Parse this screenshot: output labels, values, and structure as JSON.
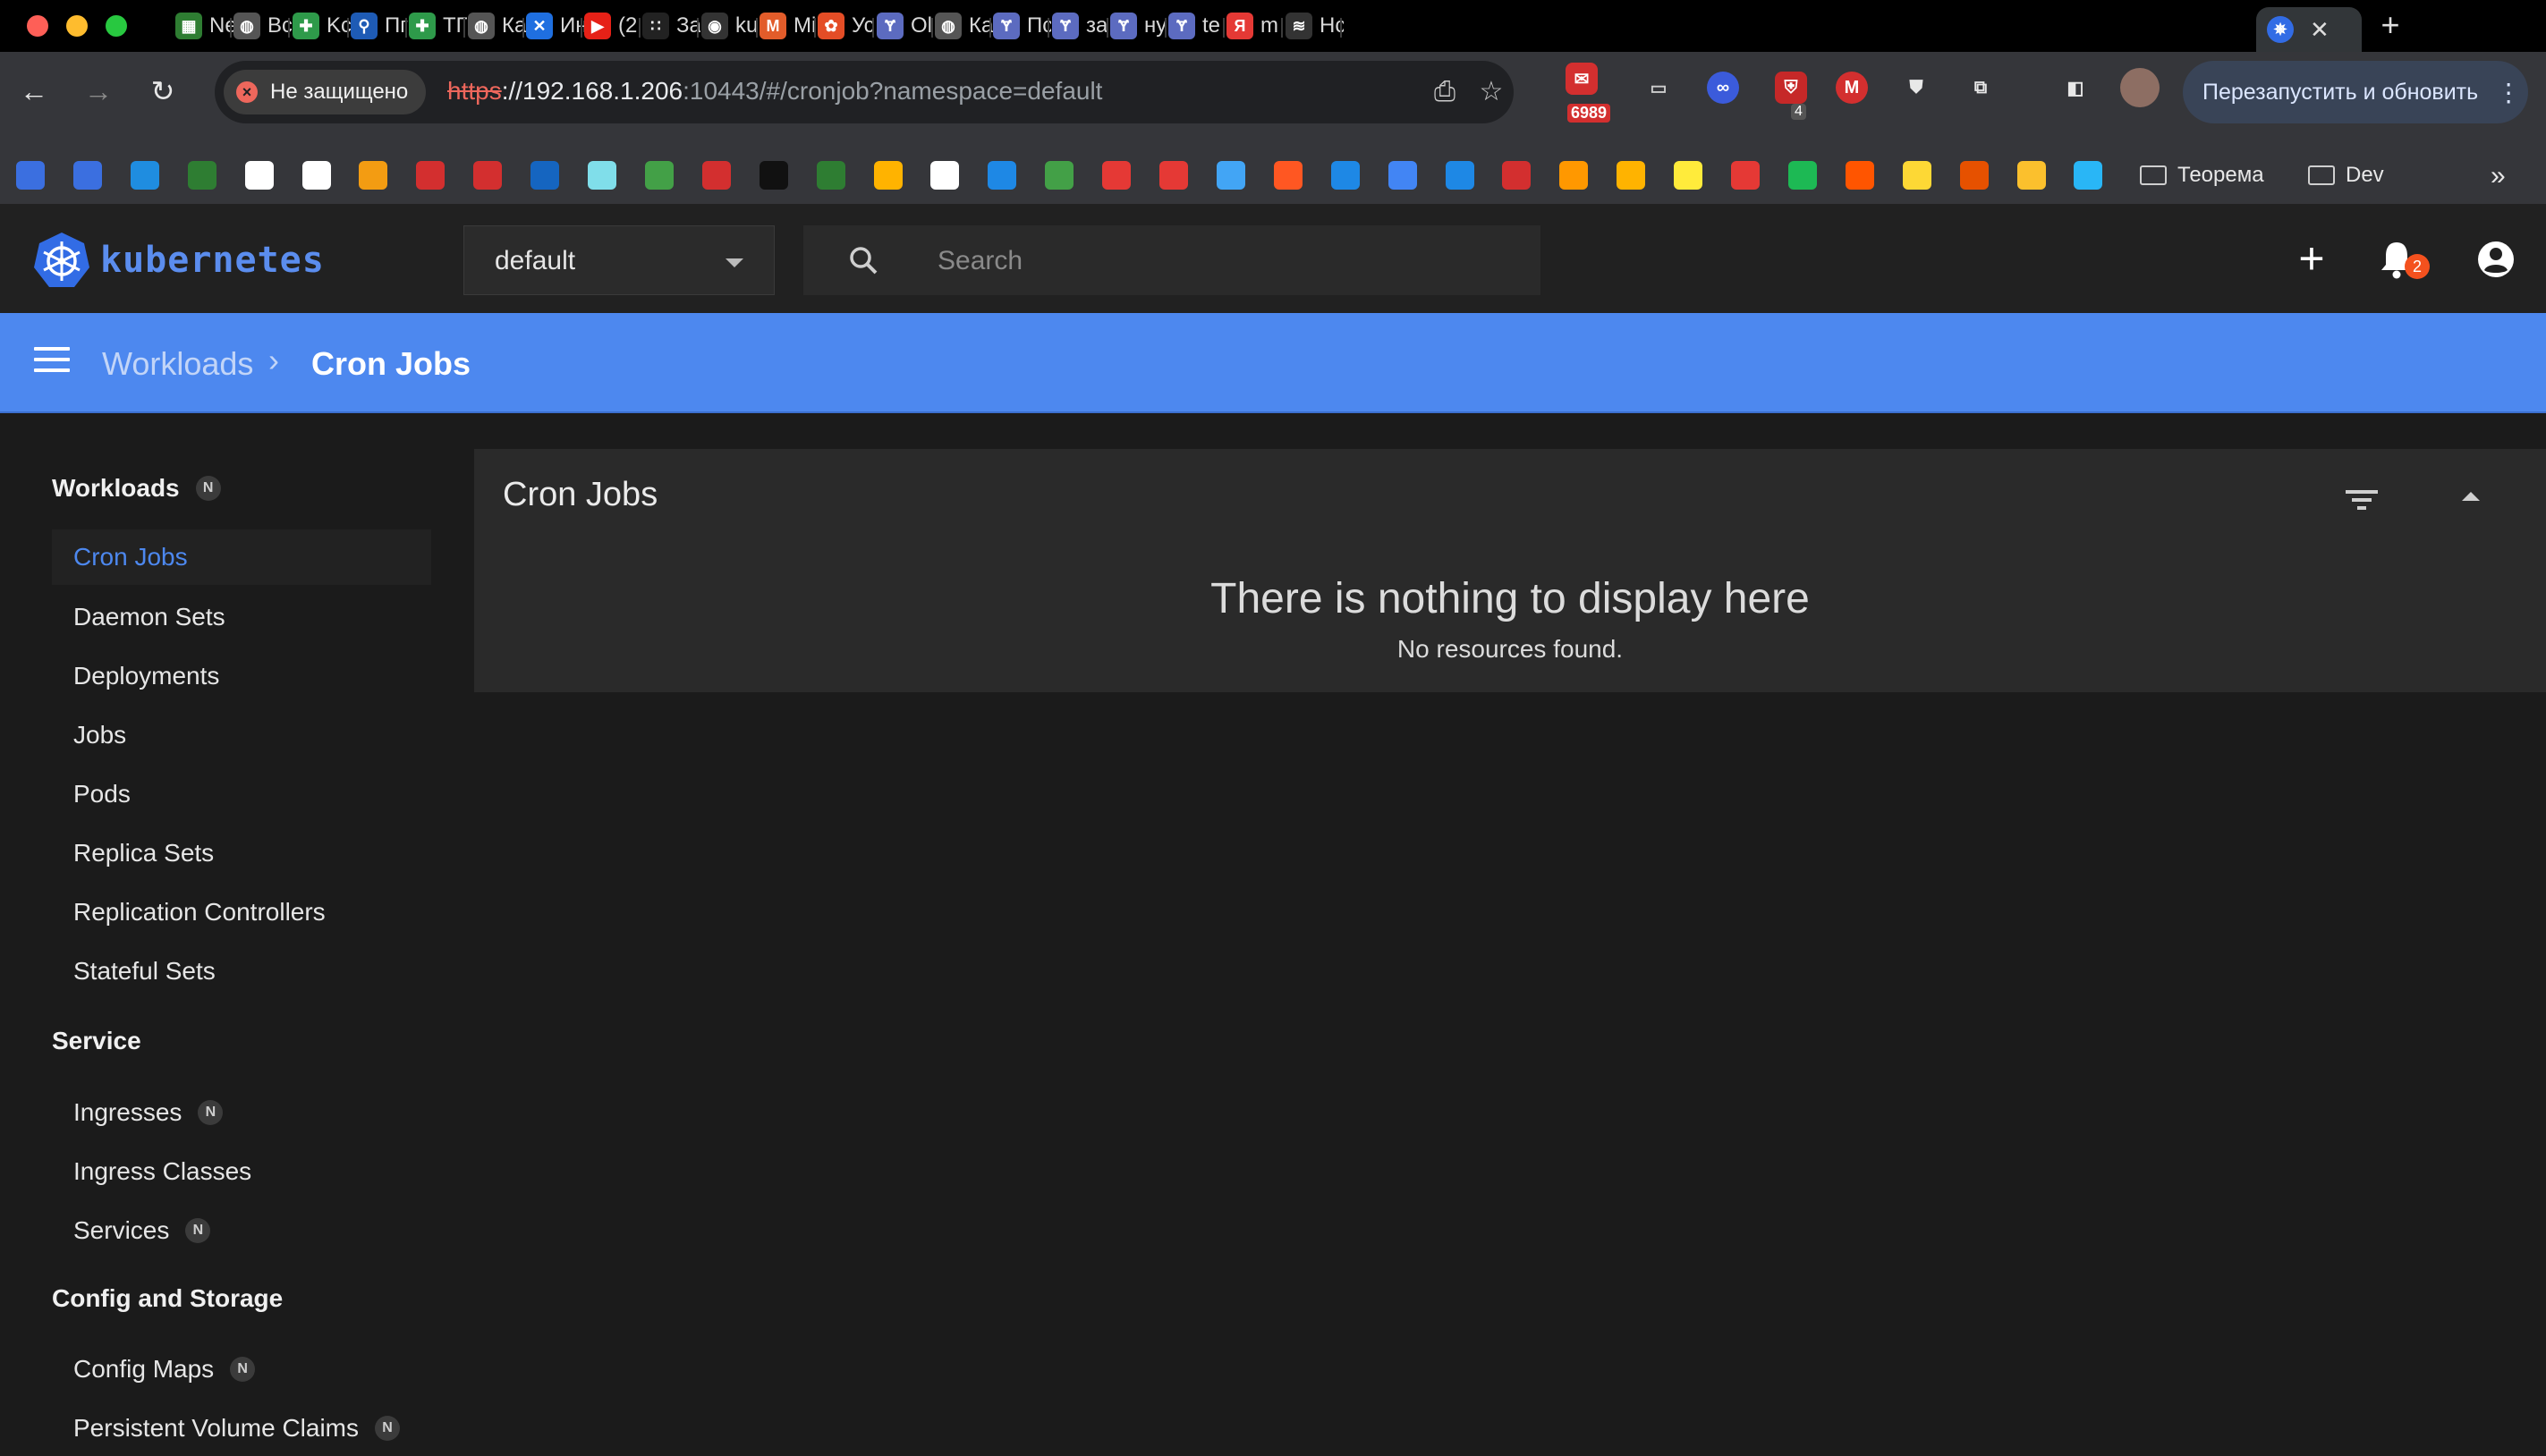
{
  "browser": {
    "tabs": [
      {
        "label": "Ne",
        "color": "#2e7d32",
        "glyph": "▦"
      },
      {
        "label": "Bc",
        "color": "#555555",
        "glyph": "◍"
      },
      {
        "label": "Kc",
        "color": "#2e9a4a",
        "glyph": "✚"
      },
      {
        "label": "Пг",
        "color": "#1e5bb5",
        "glyph": "⚲"
      },
      {
        "label": "ТП",
        "color": "#2e9a4a",
        "glyph": "✚"
      },
      {
        "label": "Кa",
        "color": "#555555",
        "glyph": "◍"
      },
      {
        "label": "Ин",
        "color": "#1f6fe0",
        "glyph": "✕"
      },
      {
        "label": "(2",
        "color": "#e62117",
        "glyph": "▶"
      },
      {
        "label": "За",
        "color": "#222222",
        "glyph": "∷"
      },
      {
        "label": "ku",
        "color": "#333333",
        "glyph": "◉"
      },
      {
        "label": "Mi",
        "color": "#e25c2a",
        "glyph": "M"
      },
      {
        "label": "Ус",
        "color": "#e44d26",
        "glyph": "✿"
      },
      {
        "label": "Ol",
        "color": "#5c6bc0",
        "glyph": "Ɏ"
      },
      {
        "label": "Кa",
        "color": "#555555",
        "glyph": "◍"
      },
      {
        "label": "Пс",
        "color": "#5c6bc0",
        "glyph": "Ɏ"
      },
      {
        "label": "за",
        "color": "#5c6bc0",
        "glyph": "Ɏ"
      },
      {
        "label": "ну",
        "color": "#5c6bc0",
        "glyph": "Ɏ"
      },
      {
        "label": "te",
        "color": "#5c6bc0",
        "glyph": "Ɏ"
      },
      {
        "label": "m",
        "color": "#e53935",
        "glyph": "Я"
      },
      {
        "label": "Нс",
        "color": "#333333",
        "glyph": "≋"
      }
    ],
    "active_tab_close": "✕",
    "new_tab": "+",
    "security_label": "Не защищено",
    "url_scheme": "https",
    "url_host": "://192.168.1.206",
    "url_rest": ":10443/#/cronjob?namespace=default",
    "extension_badge_count": "6989",
    "extension_badge_small": "4",
    "restart_label": "Перезапустить и обновить",
    "bookmark_folders": [
      "Теорема",
      "Dev"
    ],
    "bookmark_icons": [
      "#3b6fe0",
      "#3b6fe0",
      "#1f8de0",
      "#2e7d32",
      "#ffffff",
      "#ffffff",
      "#f39c12",
      "#d32f2f",
      "#d32f2f",
      "#1565c0",
      "#80deea",
      "#43a047",
      "#d32f2f",
      "#111111",
      "#2e7d32",
      "#ffb300",
      "#ffffff",
      "#1e88e5",
      "#43a047",
      "#e53935",
      "#e53935",
      "#42a5f5",
      "#ff5722",
      "#1e88e5",
      "#4285f4",
      "#1e88e5",
      "#d32f2f",
      "#ff9800",
      "#ffb300",
      "#ffeb3b",
      "#e53935",
      "#1db954",
      "#ff5500",
      "#fdd835",
      "#e65100",
      "#fbc02d",
      "#29b6f6"
    ]
  },
  "app": {
    "logo_text": "kubernetes",
    "namespace": "default",
    "search_placeholder": "Search",
    "notification_count": "2"
  },
  "breadcrumb": {
    "root": "Workloads",
    "separator": "›",
    "current": "Cron Jobs"
  },
  "sidebar": {
    "badge": "N",
    "workloads_header": "Workloads",
    "workloads_items": [
      "Cron Jobs",
      "Daemon Sets",
      "Deployments",
      "Jobs",
      "Pods",
      "Replica Sets",
      "Replication Controllers",
      "Stateful Sets"
    ],
    "service_header": "Service",
    "service_items": [
      "Ingresses",
      "Ingress Classes",
      "Services"
    ],
    "config_header": "Config and Storage",
    "config_items": [
      "Config Maps",
      "Persistent Volume Claims"
    ]
  },
  "main": {
    "card_title": "Cron Jobs",
    "empty_title": "There is nothing to display here",
    "empty_subtitle": "No resources found."
  },
  "colors": {
    "accent": "#4d88ef",
    "toolbar": "#212121",
    "badge": "#f4511e"
  }
}
